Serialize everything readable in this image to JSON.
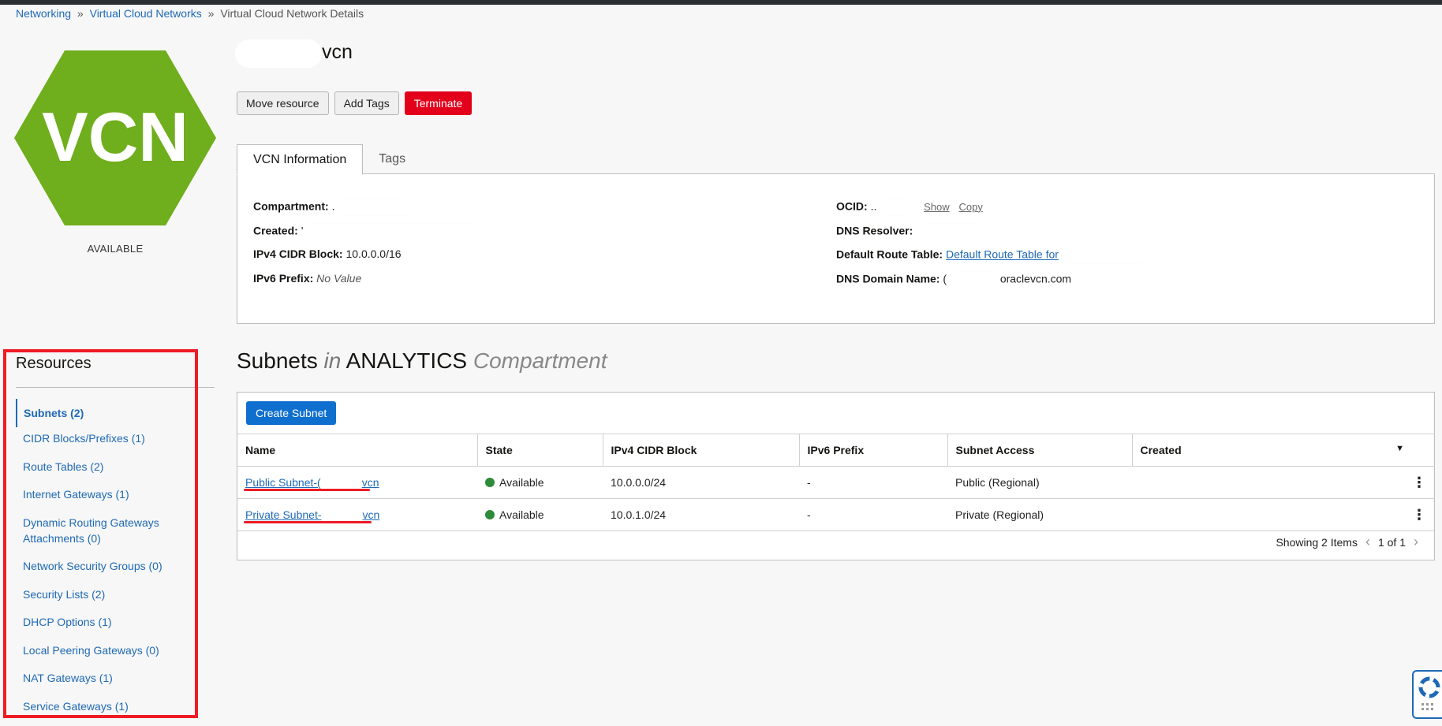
{
  "breadcrumb": {
    "items": [
      "Networking",
      "Virtual Cloud Networks"
    ],
    "separator": "»",
    "current": "Virtual Cloud Network Details"
  },
  "vcn": {
    "logo_text": "VCN",
    "logo_color": "#6fae1c",
    "state": "AVAILABLE",
    "title": "vcn"
  },
  "actions": {
    "move": "Move resource",
    "add_tags": "Add Tags",
    "terminate": "Terminate"
  },
  "tabs": [
    "VCN Information",
    "Tags"
  ],
  "info": {
    "compartment_label": "Compartment:",
    "compartment_value": ".",
    "created_label": "Created:",
    "created_value": "'",
    "ipv4_label": "IPv4 CIDR Block:",
    "ipv4_value": "10.0.0.0/16",
    "ipv6_label": "IPv6 Prefix:",
    "ipv6_value": "No Value",
    "ocid_label": "OCID:",
    "ocid_value": "..",
    "show": "Show",
    "copy": "Copy",
    "dns_resolver_label": "DNS Resolver:",
    "route_table_label": "Default Route Table:",
    "route_table_value": "Default Route Table for",
    "dns_domain_label": "DNS Domain Name:",
    "dns_domain_prefix": "(",
    "dns_domain_suffix": "oraclevcn.com"
  },
  "resources": {
    "title": "Resources",
    "items": [
      "Subnets (2)",
      "CIDR Blocks/Prefixes (1)",
      "Route Tables (2)",
      "Internet Gateways (1)",
      "Dynamic Routing Gateways Attachments (0)",
      "Network Security Groups (0)",
      "Security Lists (2)",
      "DHCP Options (1)",
      "Local Peering Gateways (0)",
      "NAT Gateways (1)",
      "Service Gateways (1)"
    ]
  },
  "subnets": {
    "title_main": "Subnets",
    "title_in": "in",
    "title_compartment": "ANALYTICS",
    "title_suffix": "Compartment",
    "create_label": "Create Subnet",
    "columns": [
      "Name",
      "State",
      "IPv4 CIDR Block",
      "IPv6 Prefix",
      "Subnet Access",
      "Created"
    ],
    "rows": [
      {
        "name_prefix": "Public Subnet-(",
        "name_suffix": "vcn",
        "state": "Available",
        "ipv4": "10.0.0.0/24",
        "ipv6": "-",
        "access": "Public (Regional)",
        "created": ""
      },
      {
        "name_prefix": "Private Subnet-",
        "name_suffix": "vcn",
        "state": "Available",
        "ipv4": "10.0.1.0/24",
        "ipv6": "-",
        "access": "Private (Regional)",
        "created": ""
      }
    ],
    "showing": "Showing 2 Items",
    "page": "1 of 1"
  },
  "icons": {
    "sort": "chevron-down-icon",
    "row_menu": "kebab-menu-icon",
    "prev": "chevron-left-icon",
    "next": "chevron-right-icon",
    "help": "lifebuoy-icon",
    "status": "status-dot-icon"
  },
  "colors": {
    "link": "#1e69b5",
    "danger": "#e3001b",
    "primary": "#0f6fce",
    "available": "#2e8b3a",
    "highlight": "#ee1c25"
  }
}
